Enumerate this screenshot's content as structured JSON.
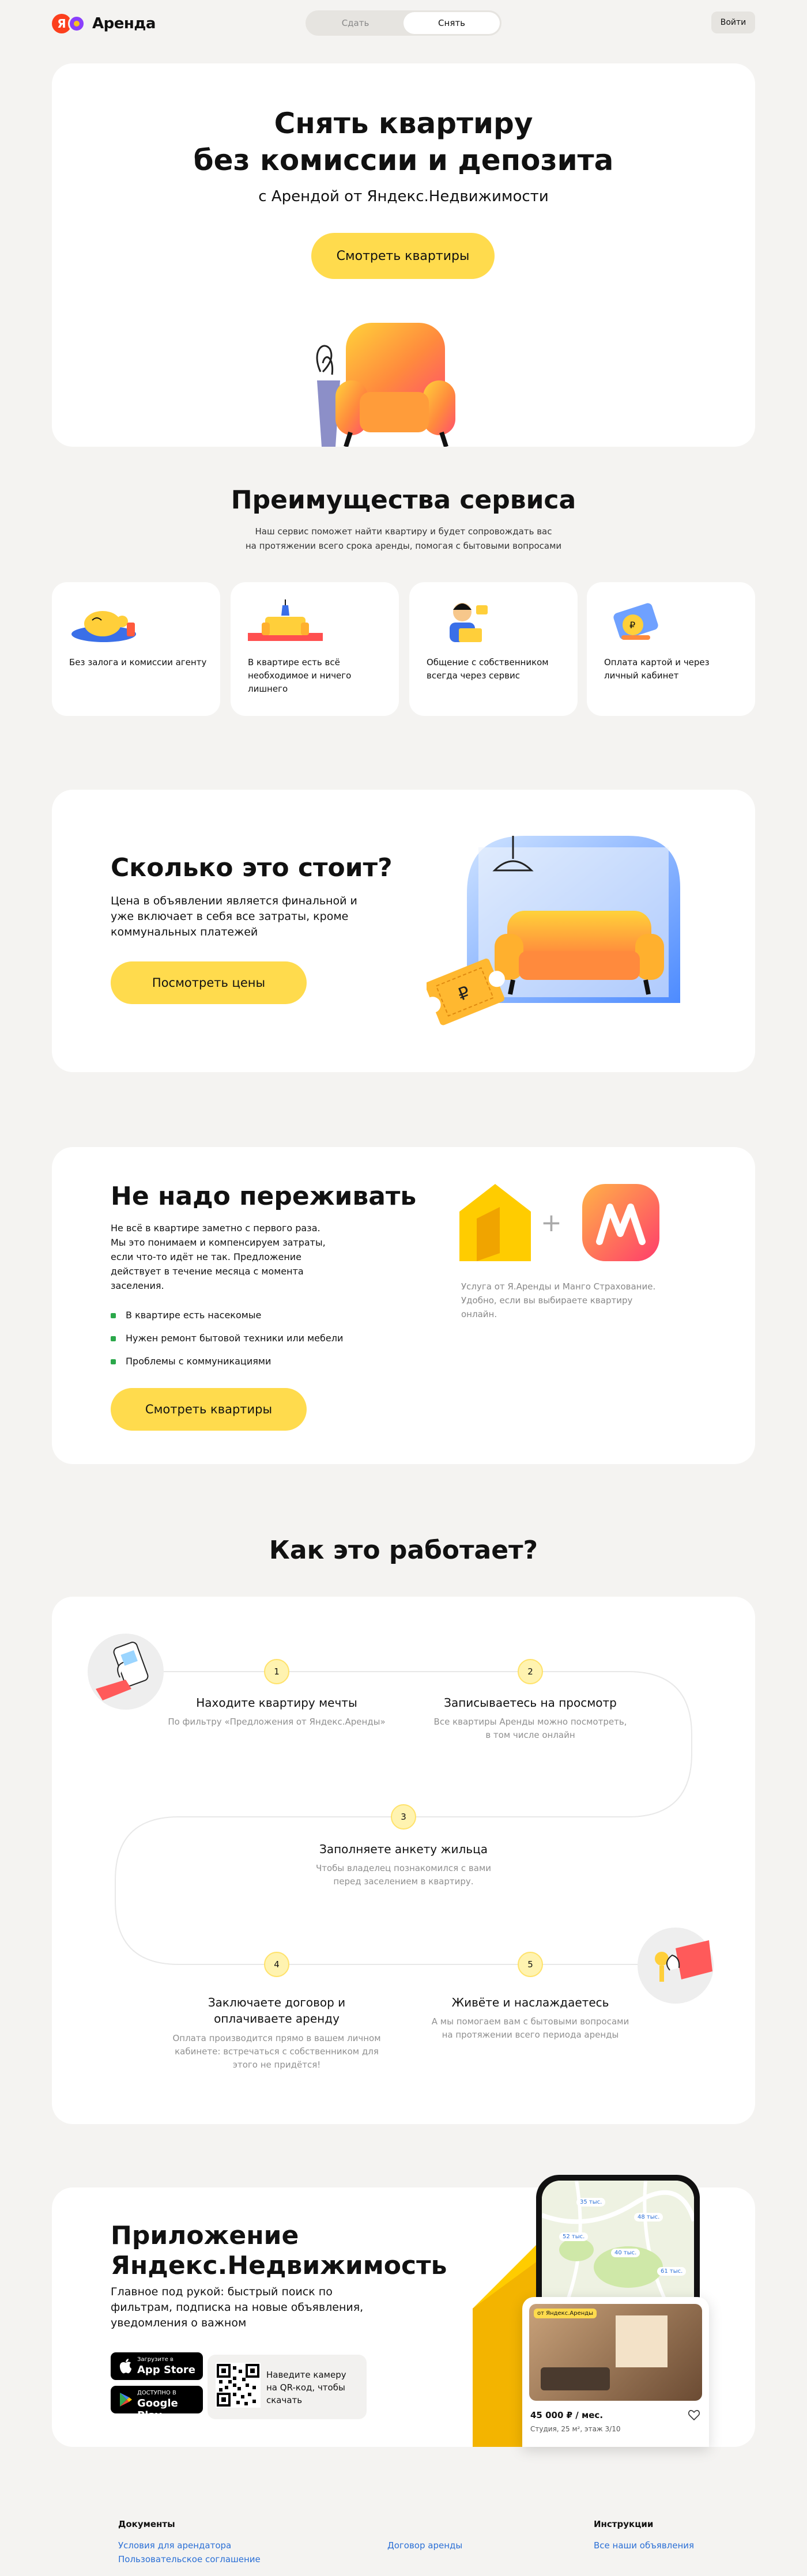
{
  "header": {
    "logo_letter": "Я",
    "logo_text": "Аренда",
    "tabs": [
      "Сдать",
      "Снять"
    ],
    "active_tab": "Снять",
    "login_label": "Войти"
  },
  "hero": {
    "title_line1": "Снять квартиру",
    "title_line2": "без комиссии и депозита",
    "subtitle": "с Арендой от Яндекс.Недвижимости",
    "button": "Смотреть квартиры"
  },
  "advantages": {
    "title": "Преимущества сервиса",
    "subtitle_line1": "Наш сервис поможет найти квартиру и будет сопровождать вас",
    "subtitle_line2": "на протяжении всего срока аренды, помогая с бытовыми вопросами",
    "items": [
      {
        "text": "Без залога и комиссии агенту"
      },
      {
        "text": "В квартире есть всё необходимое и ничего лишнего"
      },
      {
        "text": "Общение с собственником всегда через сервис"
      },
      {
        "text": "Оплата картой и через личный кабинет"
      }
    ]
  },
  "price": {
    "title": "Сколько это стоит?",
    "desc": "Цена в объявлении является финальной и уже включает в себя все затраты, кроме коммунальных платежей",
    "button": "Посмотреть цены",
    "ticket_symbol": "₽"
  },
  "worry": {
    "title": "Не надо переживать",
    "desc": "Не всё в квартире заметно с первого раза. Мы это понимаем и компенсируем затраты, если что-то идёт не так. Предложение действует в течение месяца с момента заселения.",
    "items": [
      "В квартире есть насекомые",
      "Нужен ремонт бытовой техники или мебели",
      "Проблемы с коммуникациями"
    ],
    "button": "Смотреть квартиры",
    "insurance_text": "Услуга от Я.Аренды и Манго Страхование. Удобно, если вы выбираете квартиру онлайн.",
    "plus": "+"
  },
  "how": {
    "title": "Как это работает?",
    "steps": [
      {
        "num": "1",
        "title": "Находите квартиру мечты",
        "text": "По фильтру «Предложения от Яндекс.Аренды»"
      },
      {
        "num": "2",
        "title": "Записываетесь на просмотр",
        "text": "Все квартиры Аренды можно посмотреть, в том числе онлайн"
      },
      {
        "num": "3",
        "title": "Заполняете анкету жильца",
        "text": "Чтобы владелец познакомился с вами перед заселением в квартиру."
      },
      {
        "num": "4",
        "title": "Заключаете договор и оплачиваете аренду",
        "text": "Оплата производится прямо в вашем личном кабинете: встречаться с собственником для этого не придётся!"
      },
      {
        "num": "5",
        "title": "Живёте и наслаждаетесь",
        "text": "А мы помогаем вам с бытовыми вопросами на протяжении всего периода аренды"
      }
    ]
  },
  "app": {
    "title_line1": "Приложение",
    "title_line2": "Яндекс.Недвижимость",
    "desc": "Главное под рукой: быстрый поиск по фильтрам, подписка на новые объявления, уведомления о важном",
    "appstore_small": "Загрузите в",
    "appstore_big": "App Store",
    "gplay_small": "ДОСТУПНО В",
    "gplay_big": "Google Play",
    "qr_text": "Наведите камеру на QR-код, чтобы скачать",
    "listing_badge": "от Яндекс.Аренды",
    "listing_price": "45 000 ₽ / мес.",
    "listing_desc": "Студия, 25 м², этаж 3/10",
    "map_pins": [
      "35 тыс.",
      "48 тыс.",
      "52 тыс.",
      "40 тыс.",
      "61 тыс."
    ]
  },
  "footer": {
    "col1_head": "Документы",
    "col1_links": [
      "Условия для арендатора",
      "Пользовательское соглашение"
    ],
    "col2_link": "Договор аренды",
    "col3_head": "Инструкции",
    "col3_link": "Все наши объявления"
  }
}
